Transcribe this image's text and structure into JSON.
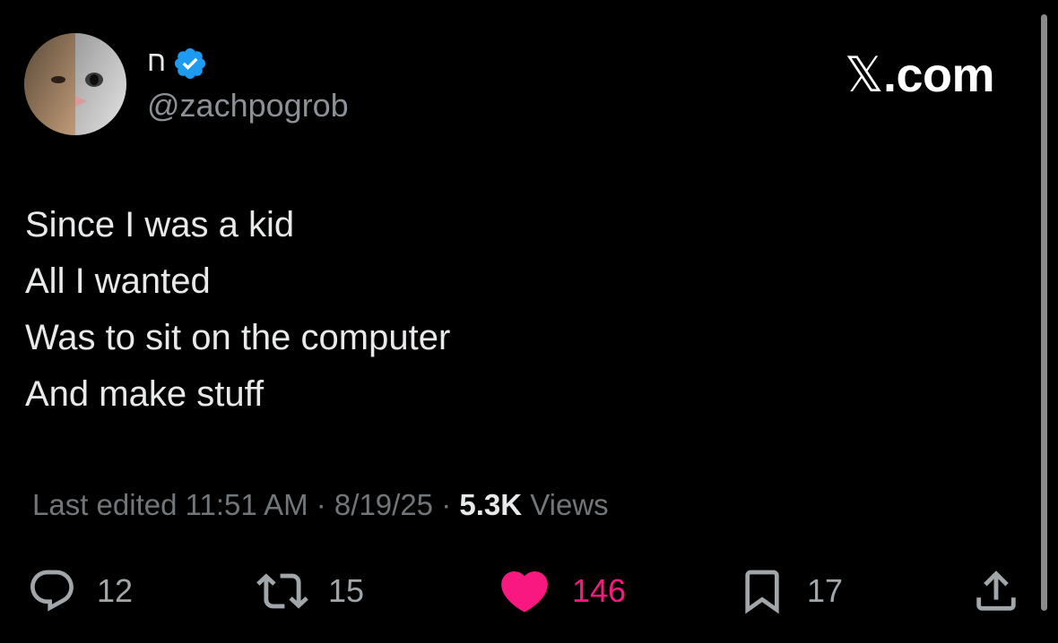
{
  "author": {
    "display_name": "ח",
    "handle": "@zachpogrob",
    "verified": true
  },
  "branding": {
    "logo_text": ".com",
    "logo_glyph": "𝕏"
  },
  "tweet": {
    "lines": [
      "Since I was a kid",
      "All I wanted",
      "Was to sit on the computer",
      "And make stuff"
    ]
  },
  "meta": {
    "edited_label": "Last edited 11:51 AM · 8/19/25",
    "separator": " · ",
    "views_count": "5.3K",
    "views_label": " Views"
  },
  "actions": {
    "replies": "12",
    "reposts": "15",
    "likes": "146",
    "bookmarks": "17"
  },
  "colors": {
    "background": "#000000",
    "text": "#e7e9ea",
    "muted": "#71767b",
    "like": "#f91880",
    "verified": "#1d9bf0"
  }
}
